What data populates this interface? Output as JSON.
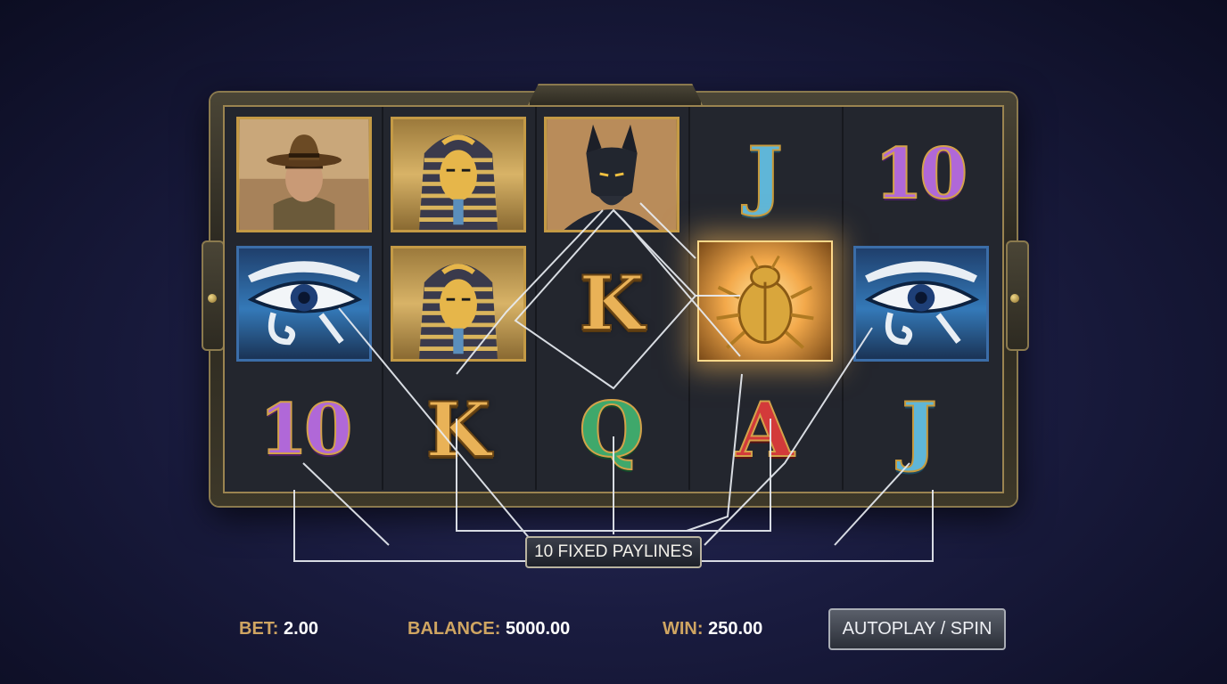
{
  "game": {
    "reels": [
      [
        {
          "symbol": "explorer",
          "icon": "explorer-icon",
          "tile": "gold"
        },
        {
          "symbol": "eye-of-horus",
          "icon": "eye-of-horus-icon",
          "tile": "blue"
        },
        {
          "symbol": "10",
          "text": "10",
          "color": "purple"
        }
      ],
      [
        {
          "symbol": "pharaoh-mask",
          "icon": "pharaoh-mask-icon",
          "tile": "gold"
        },
        {
          "symbol": "pharaoh-mask",
          "icon": "pharaoh-mask-icon",
          "tile": "gold"
        },
        {
          "symbol": "K",
          "text": "K",
          "color": "gold"
        }
      ],
      [
        {
          "symbol": "anubis",
          "icon": "anubis-icon",
          "tile": "gold"
        },
        {
          "symbol": "K",
          "text": "K",
          "color": "gold"
        },
        {
          "symbol": "Q",
          "text": "Q",
          "color": "green"
        }
      ],
      [
        {
          "symbol": "J",
          "text": "J",
          "color": "blue"
        },
        {
          "symbol": "scarab",
          "icon": "scarab-icon",
          "tile": "glow"
        },
        {
          "symbol": "A",
          "text": "A",
          "color": "red"
        }
      ],
      [
        {
          "symbol": "10",
          "text": "10",
          "color": "purple"
        },
        {
          "symbol": "eye-of-horus",
          "icon": "eye-of-horus-icon",
          "tile": "blue"
        },
        {
          "symbol": "J",
          "text": "J",
          "color": "blue"
        }
      ]
    ],
    "paylines_label": "10 FIXED PAYLINES"
  },
  "footer": {
    "bet_label": "BET:",
    "bet_value": "2.00",
    "balance_label": "BALANCE:",
    "balance_value": "5000.00",
    "win_label": "WIN:",
    "win_value": "250.00",
    "spin_button": "AUTOPLAY / SPIN"
  },
  "colors": {
    "accent_gold": "#cfa562",
    "background": "#1a1c40"
  }
}
